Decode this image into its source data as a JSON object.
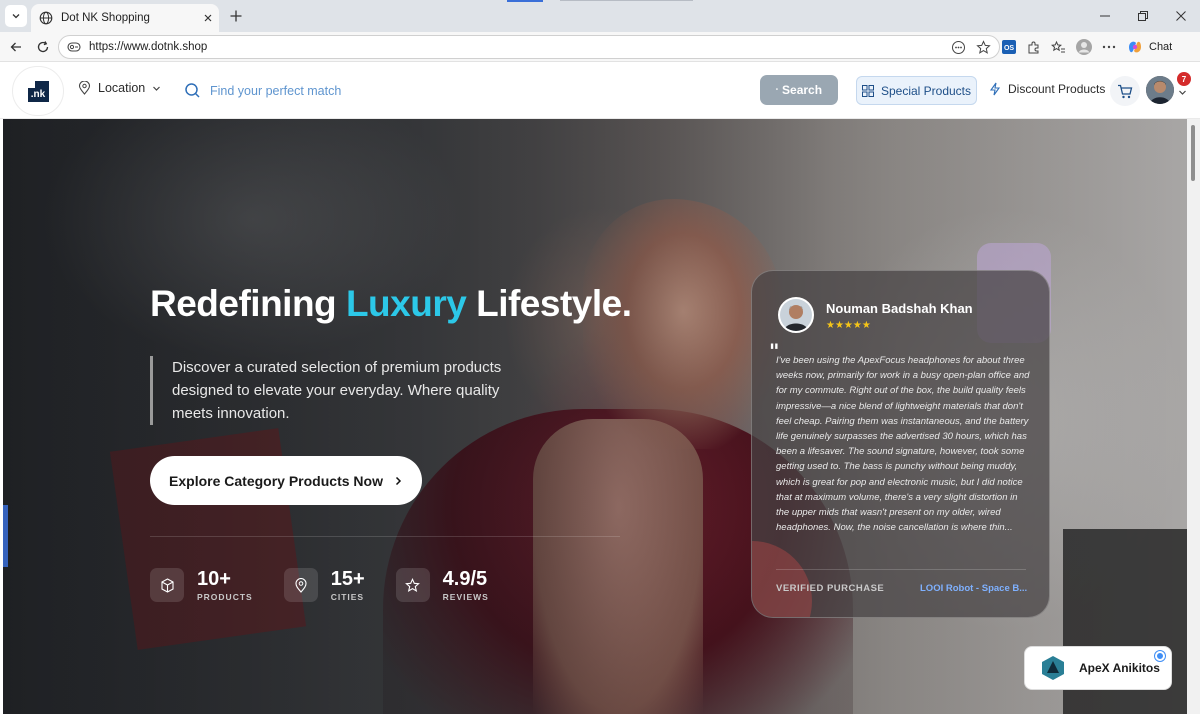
{
  "browser": {
    "tab_title": "Dot NK Shopping",
    "url": "https://www.dotnk.shop",
    "chat_label": "Chat"
  },
  "header": {
    "logo_text": ".nk",
    "location_label": "Location",
    "search_placeholder": "Find your perfect match",
    "search_button": "Search",
    "special_products": "Special Products",
    "discount_products": "Discount Products",
    "notification_count": "7"
  },
  "hero": {
    "title_part1": "Redefining ",
    "title_highlight": "Luxury",
    "title_part2": " Lifestyle.",
    "description": "Discover a curated selection of premium products designed to elevate your everyday. Where quality meets innovation.",
    "cta_label": "Explore Category Products Now",
    "stats": [
      {
        "value": "10+",
        "label": "PRODUCTS",
        "icon": "cube-icon"
      },
      {
        "value": "15+",
        "label": "CITIES",
        "icon": "map-pin-icon"
      },
      {
        "value": "4.9/5",
        "label": "REVIEWS",
        "icon": "star-icon"
      }
    ]
  },
  "review": {
    "name": "Nouman Badshah Khan",
    "stars": "★★★★★",
    "text": "I've been using the ApexFocus headphones for about three weeks now, primarily for work in a busy open-plan office and for my commute. Right out of the box, the build quality feels impressive—a nice blend of lightweight materials that don't feel cheap. Pairing them was instantaneous, and the battery life genuinely surpasses the advertised 30 hours, which has been a lifesaver. The sound signature, however, took some getting used to. The bass is punchy without being muddy, which is great for pop and electronic music, but I did notice that at maximum volume, there's a very slight distortion in the upper mids that wasn't present on my older, wired headphones. Now, the noise cancellation is where thin...",
    "verified_label": "VERIFIED PURCHASE",
    "product": "LOOI Robot - Space B..."
  },
  "widget": {
    "label": "ApeX Anikitos"
  },
  "colors": {
    "accent": "#2cc8e8",
    "brand_navy": "#0f2747",
    "link_blue": "#7fb1ff",
    "badge_red": "#d42b2b"
  }
}
